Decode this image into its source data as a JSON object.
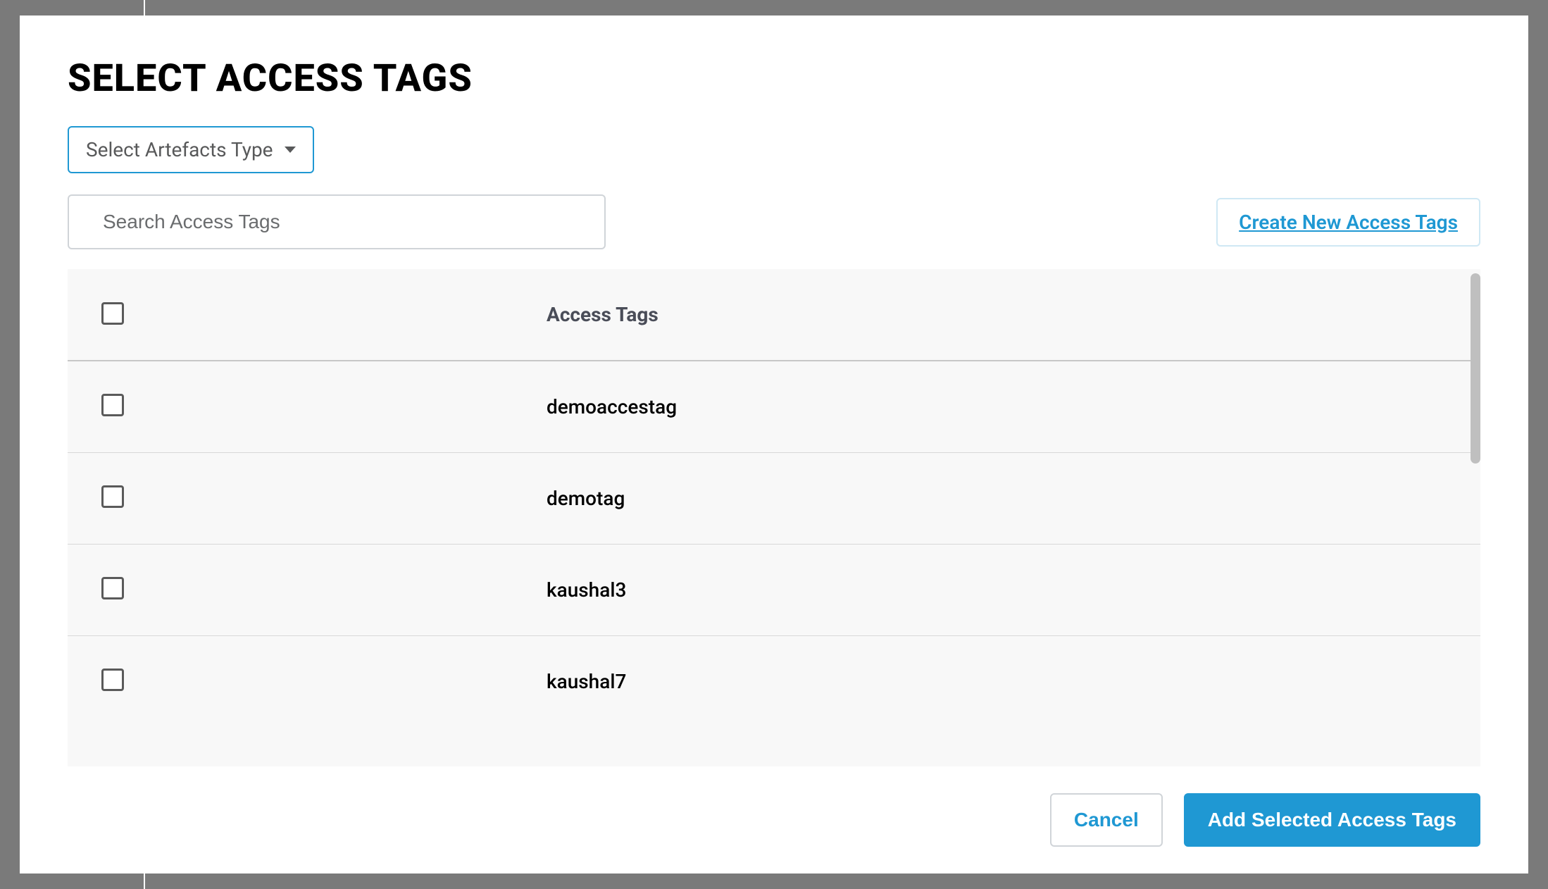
{
  "modal": {
    "title": "SELECT ACCESS TAGS",
    "artefacts_dropdown": {
      "label": "Select Artefacts Type"
    },
    "search": {
      "placeholder": "Search Access Tags"
    },
    "create_link": "Create New Access Tags",
    "table": {
      "header": "Access Tags",
      "rows": [
        {
          "name": "demoaccestag"
        },
        {
          "name": "demotag"
        },
        {
          "name": "kaushal3"
        },
        {
          "name": "kaushal7"
        }
      ]
    },
    "footer": {
      "cancel": "Cancel",
      "primary": "Add Selected Access Tags"
    }
  }
}
